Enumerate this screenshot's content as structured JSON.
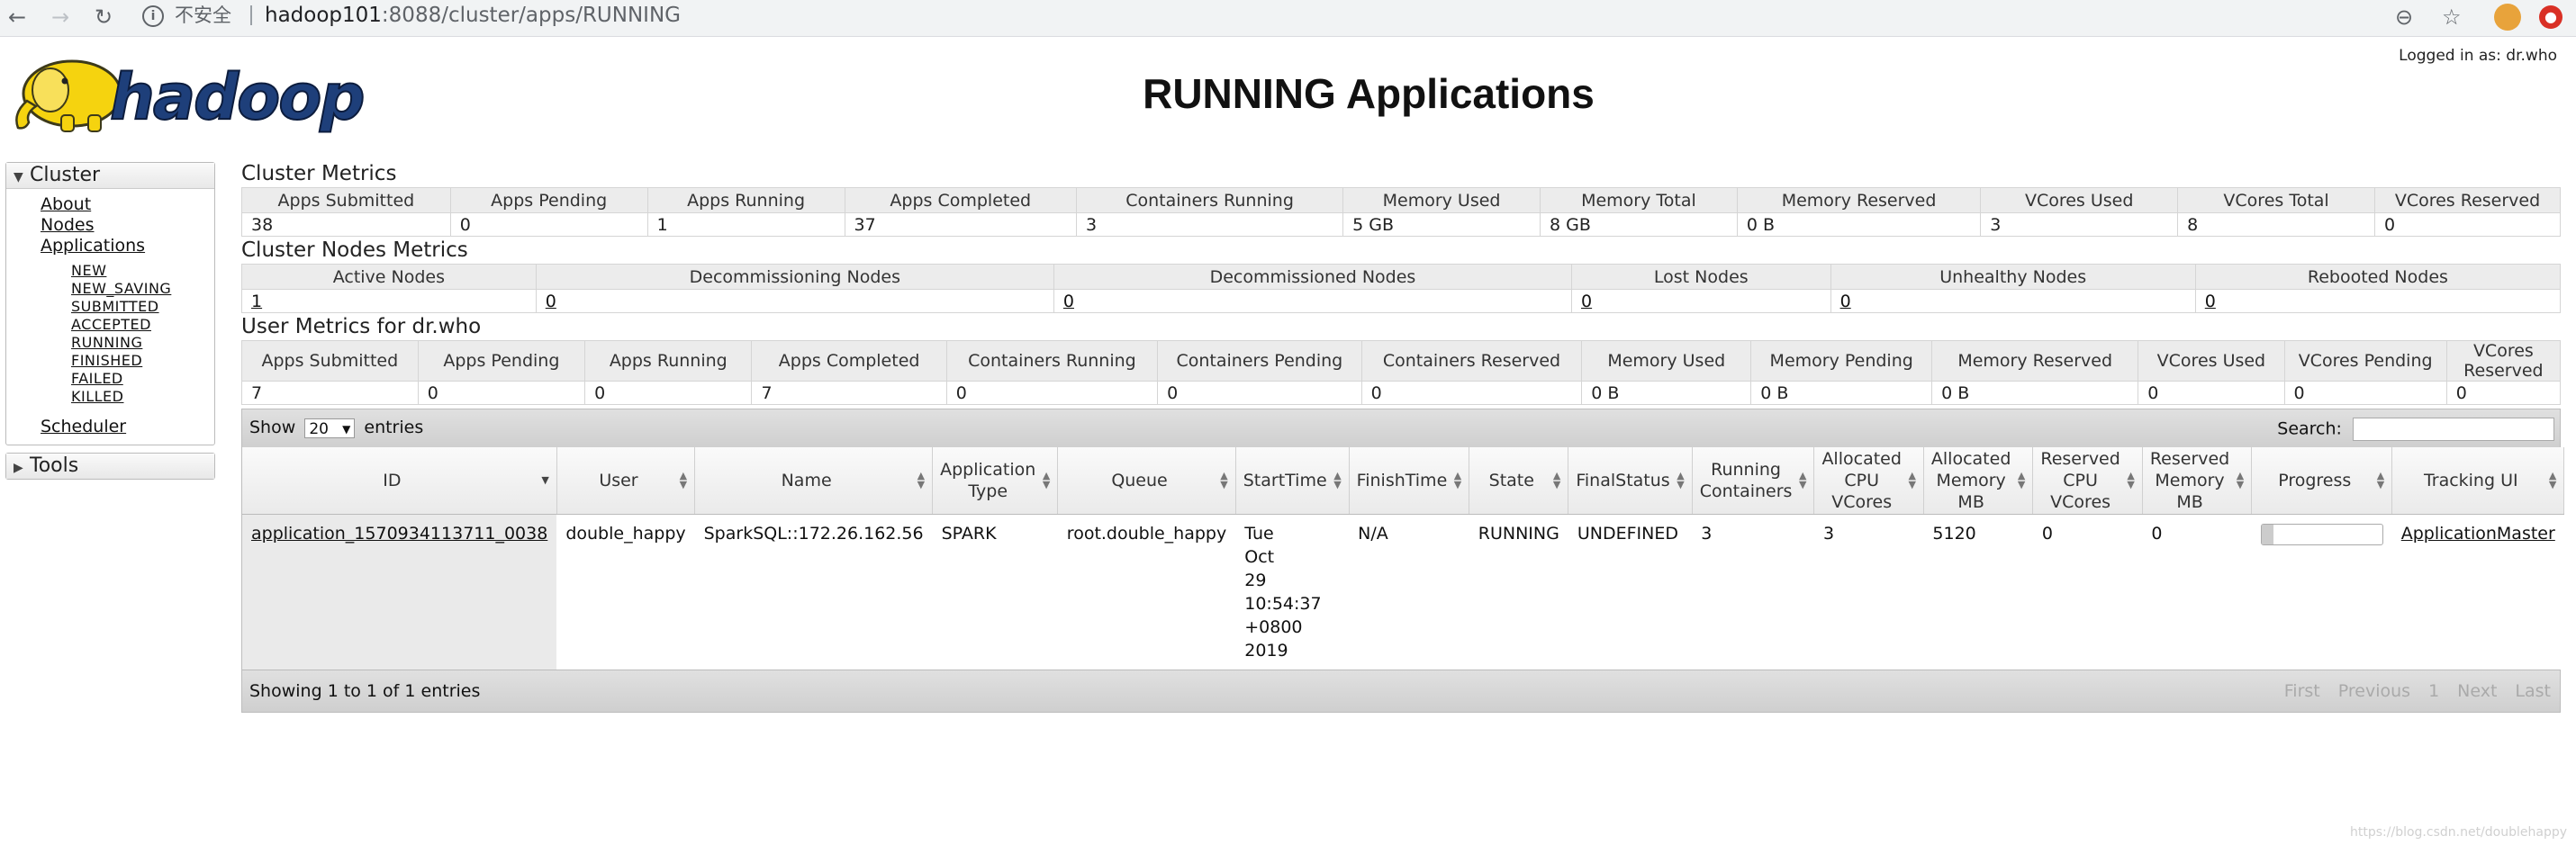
{
  "browser": {
    "insecure_label": "不安全",
    "url_host": "hadoop101",
    "url_rest": ":8088/cluster/apps/RUNNING"
  },
  "header": {
    "title": "RUNNING Applications",
    "logged_in": "Logged in as: dr.who"
  },
  "sidebar": {
    "cluster_label": "Cluster",
    "links": [
      "About",
      "Nodes",
      "Applications"
    ],
    "app_states": [
      "NEW",
      "NEW_SAVING",
      "SUBMITTED",
      "ACCEPTED",
      "RUNNING",
      "FINISHED",
      "FAILED",
      "KILLED"
    ],
    "scheduler_label": "Scheduler",
    "tools_label": "Tools"
  },
  "cluster_metrics": {
    "title": "Cluster Metrics",
    "headers": [
      "Apps Submitted",
      "Apps Pending",
      "Apps Running",
      "Apps Completed",
      "Containers Running",
      "Memory Used",
      "Memory Total",
      "Memory Reserved",
      "VCores Used",
      "VCores Total",
      "VCores Reserved"
    ],
    "values": [
      "38",
      "0",
      "1",
      "37",
      "3",
      "5 GB",
      "8 GB",
      "0 B",
      "3",
      "8",
      "0"
    ]
  },
  "cluster_nodes": {
    "title": "Cluster Nodes Metrics",
    "headers": [
      "Active Nodes",
      "Decommissioning Nodes",
      "Decommissioned Nodes",
      "Lost Nodes",
      "Unhealthy Nodes",
      "Rebooted Nodes"
    ],
    "values": [
      "1",
      "0",
      "0",
      "0",
      "0",
      "0"
    ]
  },
  "user_metrics": {
    "title": "User Metrics for dr.who",
    "headers": [
      "Apps Submitted",
      "Apps Pending",
      "Apps Running",
      "Apps Completed",
      "Containers Running",
      "Containers Pending",
      "Containers Reserved",
      "Memory Used",
      "Memory Pending",
      "Memory Reserved",
      "VCores Used",
      "VCores Pending",
      "VCores Reserved"
    ],
    "values": [
      "7",
      "0",
      "0",
      "7",
      "0",
      "0",
      "0",
      "0 B",
      "0 B",
      "0 B",
      "0",
      "0",
      "0"
    ]
  },
  "apps_table": {
    "show_label": "Show",
    "entries_label": "entries",
    "page_length": "20",
    "search_label": "Search:",
    "headers": [
      {
        "label": "ID"
      },
      {
        "label": "User"
      },
      {
        "label": "Name"
      },
      {
        "label": "Application Type"
      },
      {
        "label": "Queue"
      },
      {
        "label": "StartTime"
      },
      {
        "label": "FinishTime"
      },
      {
        "label": "State"
      },
      {
        "label": "FinalStatus"
      },
      {
        "label": "Running Containers"
      },
      {
        "label": "Allocated CPU VCores"
      },
      {
        "label": "Allocated Memory MB"
      },
      {
        "label": "Reserved CPU VCores"
      },
      {
        "label": "Reserved Memory MB"
      },
      {
        "label": "Progress"
      },
      {
        "label": "Tracking UI"
      }
    ],
    "rows": [
      {
        "id": "application_1570934113711_0038",
        "user": "double_happy",
        "name": "SparkSQL::172.26.162.56",
        "type": "SPARK",
        "queue": "root.double_happy",
        "start_time": "Tue Oct 29 10:54:37 +0800 2019",
        "finish_time": "N/A",
        "state": "RUNNING",
        "final_status": "UNDEFINED",
        "running_containers": "3",
        "alloc_vcores": "3",
        "alloc_memory": "5120",
        "reserved_vcores": "0",
        "reserved_memory": "0",
        "progress": 0.1,
        "tracking_ui": "ApplicationMaster"
      }
    ],
    "info": "Showing 1 to 1 of 1 entries",
    "pager": [
      "First",
      "Previous",
      "1",
      "Next",
      "Last"
    ]
  },
  "watermark": "https://blog.csdn.net/doublehappy"
}
